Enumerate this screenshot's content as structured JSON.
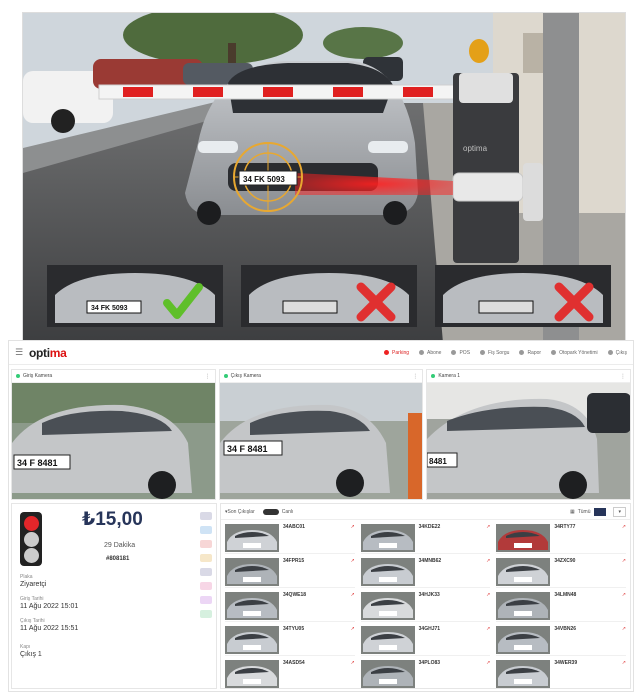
{
  "hero": {
    "barrier_brand": "optima",
    "plate_text": "34 FK 5093",
    "check_tiles": [
      {
        "plate": "34 FK 5093",
        "result": "match"
      },
      {
        "plate": "",
        "result": "fail"
      },
      {
        "plate": "",
        "result": "fail"
      }
    ],
    "colors": {
      "sky": "#cfd6dc",
      "barrier_red": "#e02020",
      "check_green": "#5fbf2a",
      "fail_red": "#e03030"
    }
  },
  "app": {
    "logo_main": "opti",
    "logo_accent": "ma",
    "nav": [
      {
        "label": "Parking",
        "active": true
      },
      {
        "label": "Abone",
        "active": false
      },
      {
        "label": "POS",
        "active": false
      },
      {
        "label": "Fiş Sorgu",
        "active": false
      },
      {
        "label": "Rapor",
        "active": false
      },
      {
        "label": "Otopark Yönetimi",
        "active": false
      },
      {
        "label": "Çıkış",
        "active": false
      }
    ],
    "cameras": [
      {
        "title": "Giriş Kamera",
        "plate": "34 F 8481"
      },
      {
        "title": "Çıkış Kamera",
        "plate": "34 F 8481"
      },
      {
        "title": "Kamera 1",
        "plate": "8481"
      }
    ],
    "exit": {
      "fee": "₺15,00",
      "duration": "29 Dakika",
      "ticket": "#808181",
      "fields": [
        {
          "label": "Plaka",
          "value": "Ziyaretçi"
        },
        {
          "label": "Giriş Tarihi",
          "value": "11 Ağu 2022 15:01"
        },
        {
          "label": "Çıkış Tarihi",
          "value": "11 Ağu 2022 15:51"
        },
        {
          "label": "Kapı",
          "value": "Çıkış 1"
        }
      ]
    },
    "records_header": {
      "filter_label": "Son Çıkışlar",
      "toggle_label": "Canlı",
      "view_label": "Tümü"
    },
    "records": [
      {
        "plate": "34ABC01"
      },
      {
        "plate": "34KDE22"
      },
      {
        "plate": "34RTY77"
      },
      {
        "plate": "34FPR15"
      },
      {
        "plate": "34MNB62"
      },
      {
        "plate": "34ZXC90"
      },
      {
        "plate": "34QWE18"
      },
      {
        "plate": "34HJK33"
      },
      {
        "plate": "34LMN48"
      },
      {
        "plate": "34TYU05"
      },
      {
        "plate": "34GHJ71"
      },
      {
        "plate": "34VBN26"
      },
      {
        "plate": "34ASD54"
      },
      {
        "plate": "34PLO83"
      },
      {
        "plate": "34WER39"
      }
    ]
  }
}
